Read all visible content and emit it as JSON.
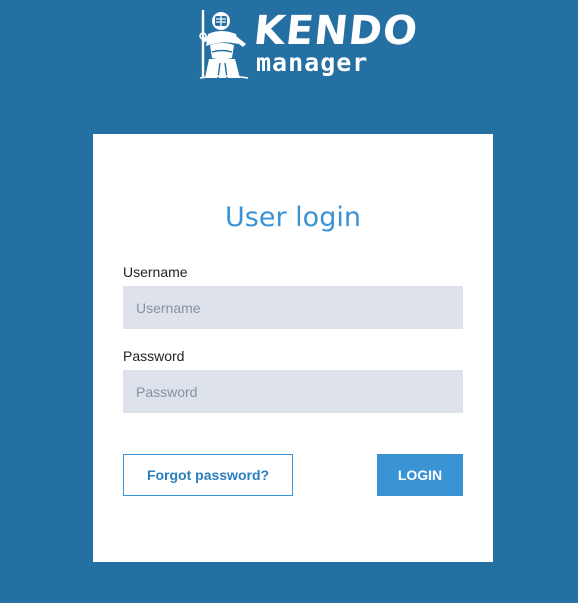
{
  "brand": {
    "title": "KENDO",
    "subtitle": "manager",
    "logo_icon": "kendo-fighter-icon",
    "background_color": "#2470a3",
    "accent_color": "#3a93d4"
  },
  "login": {
    "title": "User login",
    "username": {
      "label": "Username",
      "placeholder": "Username",
      "value": ""
    },
    "password": {
      "label": "Password",
      "placeholder": "Password",
      "value": ""
    },
    "forgot_label": "Forgot password?",
    "login_label": "LOGIN"
  }
}
